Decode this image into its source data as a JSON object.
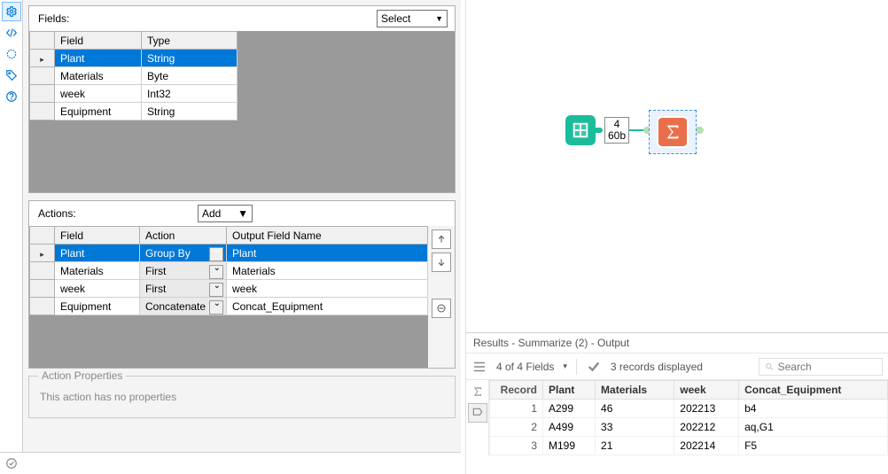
{
  "config": {
    "fields_label": "Fields:",
    "select_label": "Select",
    "fields_headers": {
      "field": "Field",
      "type": "Type"
    },
    "fields_rows": [
      {
        "field": "Plant",
        "type": "String"
      },
      {
        "field": "Materials",
        "type": "Byte"
      },
      {
        "field": "week",
        "type": "Int32"
      },
      {
        "field": "Equipment",
        "type": "String"
      }
    ],
    "actions_label": "Actions:",
    "add_label": "Add",
    "actions_headers": {
      "field": "Field",
      "action": "Action",
      "outname": "Output Field Name"
    },
    "actions_rows": [
      {
        "field": "Plant",
        "action": "Group By",
        "outname": "Plant"
      },
      {
        "field": "Materials",
        "action": "First",
        "outname": "Materials"
      },
      {
        "field": "week",
        "action": "First",
        "outname": "week"
      },
      {
        "field": "Equipment",
        "action": "Concatenate",
        "outname": "Concat_Equipment"
      }
    ],
    "props_title": "Action Properties",
    "props_text": "This action has no properties"
  },
  "canvas": {
    "meta_count": "4",
    "meta_size": "60b"
  },
  "results": {
    "title": "Results - Summarize (2) - Output",
    "fields_summary": "4 of 4 Fields",
    "records_summary": "3 records displayed",
    "search_placeholder": "Search",
    "headers": {
      "record": "Record",
      "plant": "Plant",
      "materials": "Materials",
      "week": "week",
      "concat": "Concat_Equipment"
    },
    "rows": [
      {
        "n": "1",
        "plant": "A299",
        "materials": "46",
        "week": "202213",
        "concat": "b4"
      },
      {
        "n": "2",
        "plant": "A499",
        "materials": "33",
        "week": "202212",
        "concat": "aq,G1"
      },
      {
        "n": "3",
        "plant": "M199",
        "materials": "21",
        "week": "202214",
        "concat": "F5"
      }
    ]
  }
}
